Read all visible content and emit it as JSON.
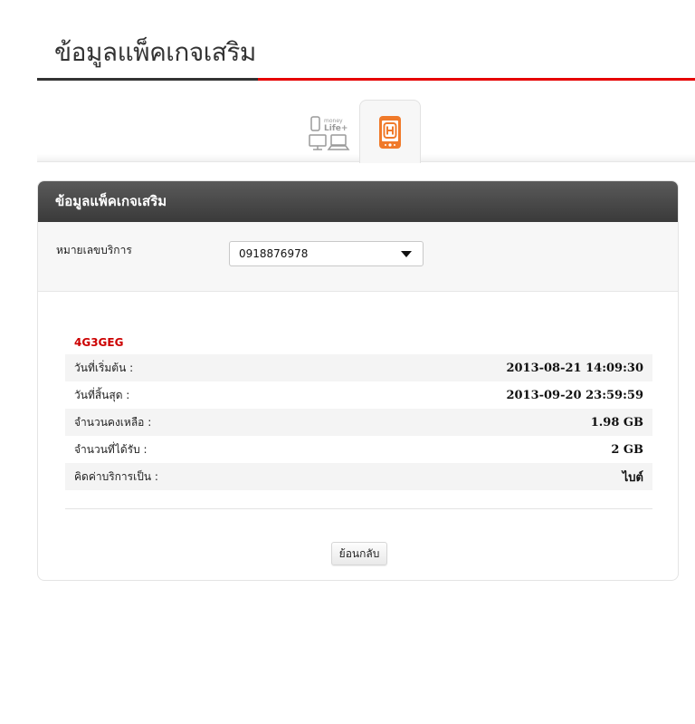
{
  "page": {
    "title": "ข้อมูลแพ็คเกจเสริม"
  },
  "tabs": [
    {
      "id": "money",
      "label": "money",
      "sublabel": "Life+",
      "active": false
    },
    {
      "id": "mobile",
      "label": "",
      "active": true
    }
  ],
  "panel": {
    "header": "ข้อมูลแพ็คเกจเสริม",
    "selector": {
      "label": "หมายเลขบริการ",
      "selected": "0918876978"
    },
    "package": {
      "name": "4G3GEG",
      "rows": [
        {
          "label": "วันที่เริ่มต้น :",
          "value": "2013-08-21 14:09:30"
        },
        {
          "label": "วันที่สิ้นสุด :",
          "value": "2013-09-20 23:59:59"
        },
        {
          "label": "จำนวนคงเหลือ :",
          "value": "1.98 GB"
        },
        {
          "label": "จำนวนที่ได้รับ :",
          "value": "2 GB"
        },
        {
          "label": "คิดค่าบริการเป็น :",
          "value": "ไบต์"
        }
      ]
    },
    "back_label": "ย้อนกลับ"
  },
  "colors": {
    "accent": "#e60000",
    "package_name": "#cc0000",
    "mobile_icon": "#f07a2a",
    "header_bg": "#454545"
  }
}
